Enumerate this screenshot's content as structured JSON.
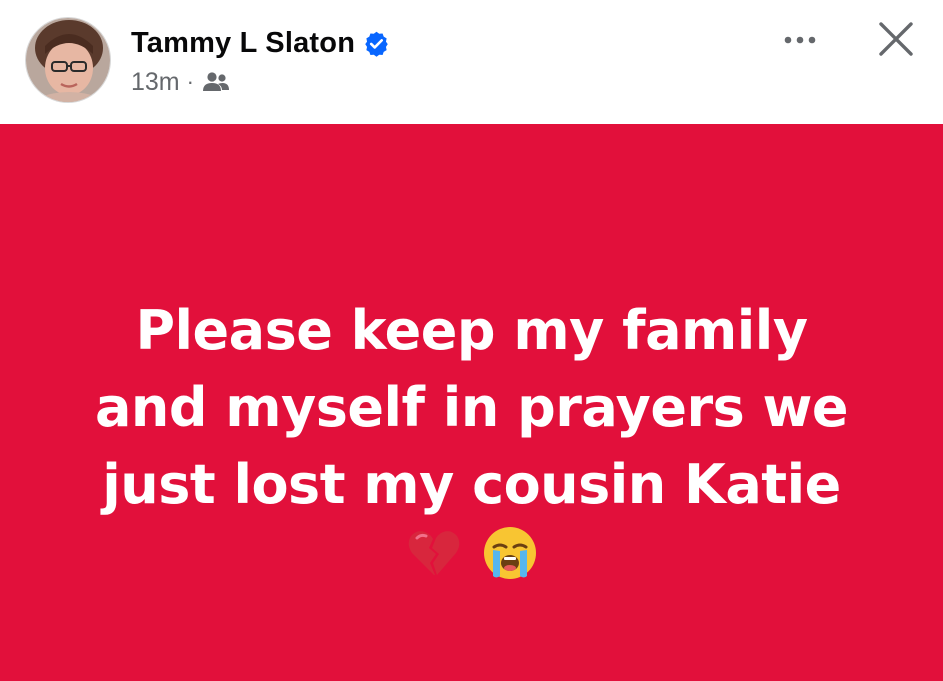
{
  "post": {
    "author_name": "Tammy L Slaton",
    "timestamp": "13m",
    "separator": "·",
    "audience_icon": "friends-icon",
    "verified_icon": "verified-badge-icon",
    "more_icon": "more-options-icon",
    "close_icon": "close-icon",
    "avatar": "profile-photo",
    "background_color": "#e2103b",
    "text_color": "#ffffff",
    "status_lines": [
      "Please keep my family",
      "and myself in prayers we",
      "just lost my cousin Katie"
    ],
    "emojis": [
      "broken-heart-emoji",
      "loudly-crying-face-emoji"
    ]
  }
}
